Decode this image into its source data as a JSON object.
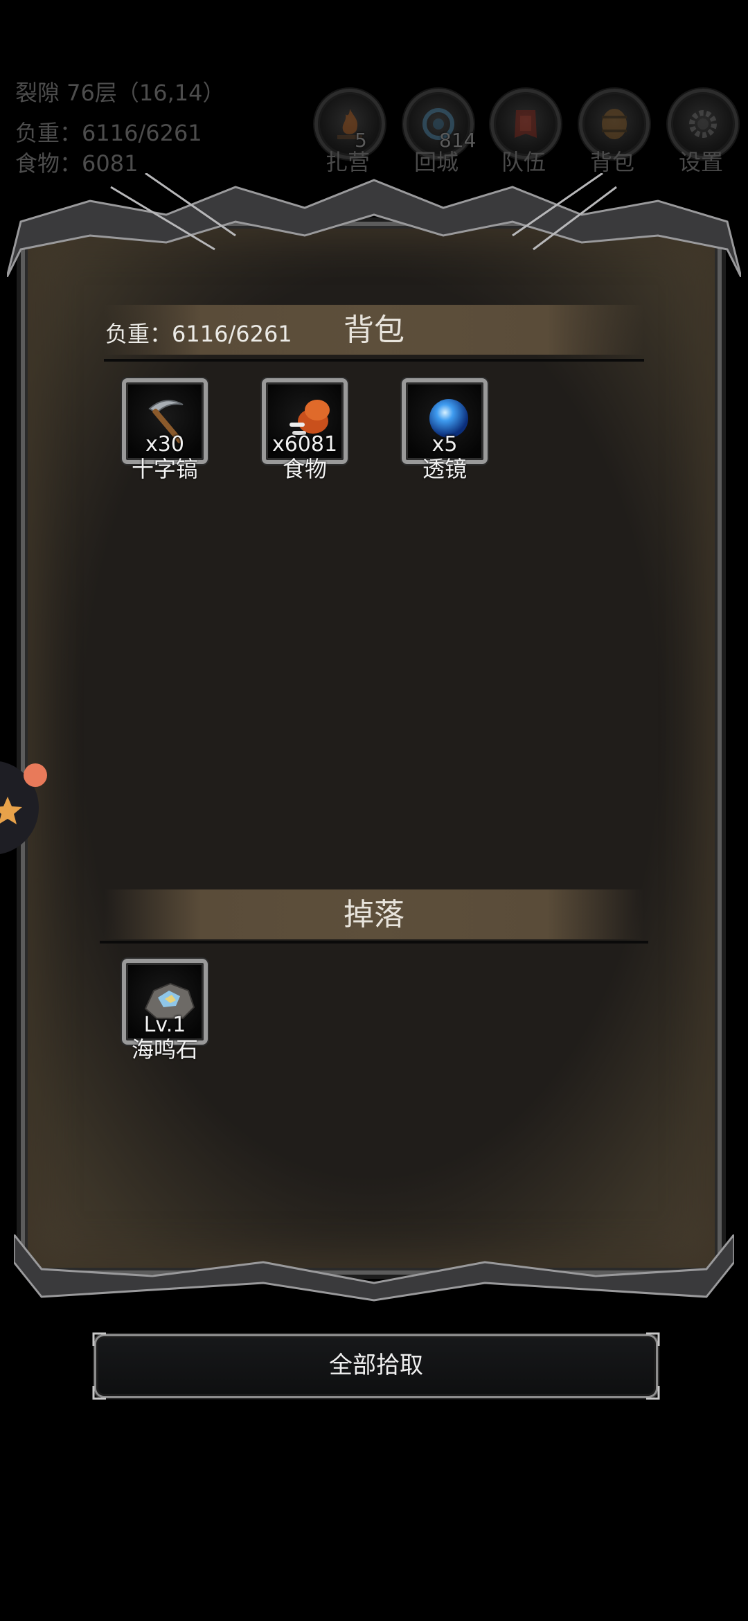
{
  "hud": {
    "location": "裂隙 76层（16,14）",
    "weight_line": "负重：6116/6261",
    "food_line": "食物：6081",
    "buttons": [
      {
        "label": "扎营",
        "badge": "5",
        "icon": "campfire-icon"
      },
      {
        "label": "回城",
        "badge": "814",
        "icon": "portal-icon"
      },
      {
        "label": "队伍",
        "badge": "",
        "icon": "team-icon"
      },
      {
        "label": "背包",
        "badge": "",
        "icon": "barrel-icon"
      },
      {
        "label": "设置",
        "badge": "",
        "icon": "gear-icon"
      }
    ]
  },
  "bag": {
    "title": "背包",
    "weight": "负重：6116/6261",
    "items": [
      {
        "name": "十字镐",
        "count": "x30",
        "icon": "pickaxe-icon"
      },
      {
        "name": "食物",
        "count": "x6081",
        "icon": "meat-icon"
      },
      {
        "name": "透镜",
        "count": "x5",
        "icon": "blue-orb-icon"
      }
    ]
  },
  "drops": {
    "title": "掉落",
    "items": [
      {
        "name": "海鸣石",
        "level": "Lv.1",
        "icon": "ore-stone-icon"
      }
    ]
  },
  "actions": {
    "pickup_all": "全部拾取"
  },
  "colors": {
    "background": "#000000",
    "panel": "#201d1a",
    "header_band": "#5d4f3b",
    "text_light": "#f2f2f2",
    "hud_text_dim": "#4d4d4d"
  }
}
